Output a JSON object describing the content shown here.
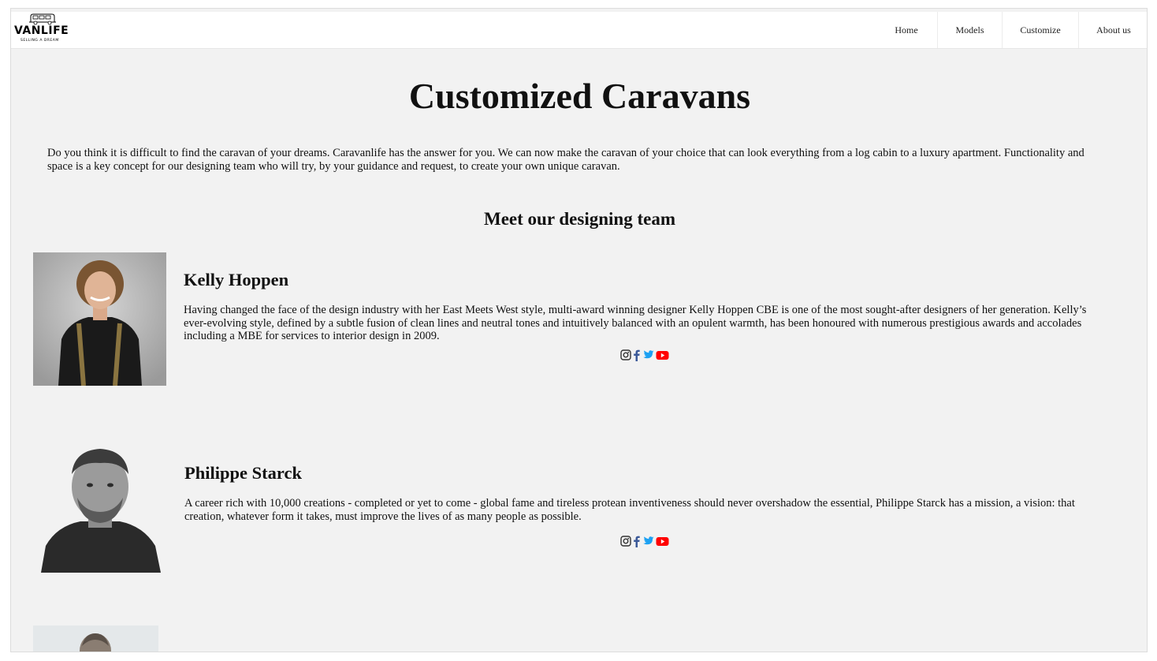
{
  "brand": {
    "name": "VANLIFE",
    "tagline": "SELLING A DREAM"
  },
  "nav": {
    "items": [
      {
        "label": "Home"
      },
      {
        "label": "Models"
      },
      {
        "label": "Customize"
      },
      {
        "label": "About us"
      }
    ]
  },
  "main": {
    "title": "Customized Caravans",
    "intro": "Do you think it is difficult to find the caravan of your dreams. Caravanlife has the answer for you. We can now make the caravan of your choice that can look everything from a log cabin to a luxury apartment. Functionality and space is a key concept for our designing team who will try, by your guidance and request, to create your own unique caravan.",
    "team_heading": "Meet our designing team"
  },
  "team": [
    {
      "name": "Kelly Hoppen",
      "bio": "Having changed the face of the design industry with her East Meets West style, multi-award winning designer Kelly Hoppen CBE is one of the most sought-after designers of her generation. Kelly’s ever-evolving style, defined by a subtle fusion of clean lines and neutral tones and intuitively balanced with an opulent warmth, has been honoured with numerous prestigious awards and accolades including a MBE for services to interior design in 2009.",
      "socials": [
        "instagram-icon",
        "facebook-icon",
        "twitter-icon",
        "youtube-icon"
      ]
    },
    {
      "name": "Philippe Starck",
      "bio": "A career rich with 10,000 creations - completed or yet to come - global fame and tireless protean inventiveness should never overshadow the essential, Philippe Starck has a mission, a vision: that creation, whatever form it takes, must improve the lives of as many people as possible.",
      "socials": [
        "instagram-icon",
        "facebook-icon",
        "twitter-icon",
        "youtube-icon"
      ]
    }
  ],
  "colors": {
    "page_background": "#f2f2f2",
    "navbar_background": "#ffffff",
    "facebook": "#3b5998",
    "twitter": "#1da1f2",
    "youtube": "#ff0000"
  }
}
